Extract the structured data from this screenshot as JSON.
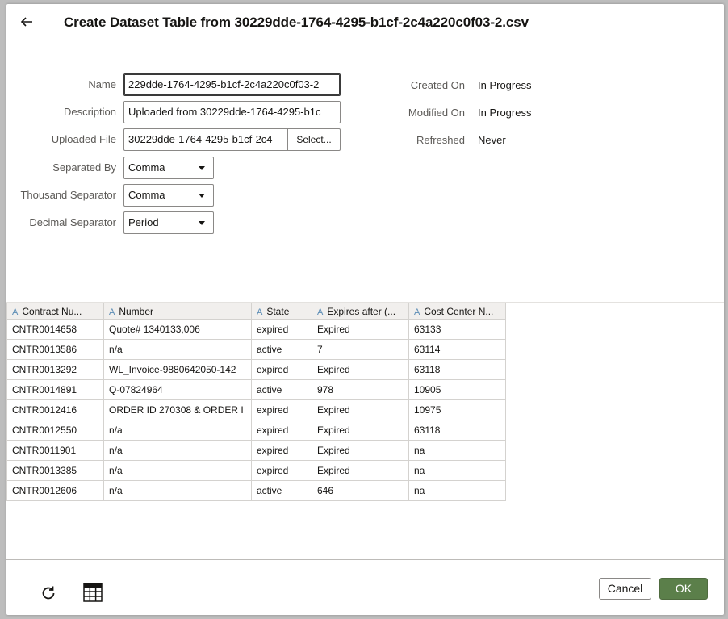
{
  "dialog": {
    "title": "Create Dataset Table from 30229dde-1764-4295-b1cf-2c4a220c0f03-2.csv"
  },
  "form": {
    "name_label": "Name",
    "name_value": "229dde-1764-4295-b1cf-2c4a220c0f03-2",
    "description_label": "Description",
    "description_value": "Uploaded from 30229dde-1764-4295-b1c",
    "uploaded_file_label": "Uploaded File",
    "uploaded_file_value": "30229dde-1764-4295-b1cf-2c4",
    "select_button": "Select...",
    "separated_by_label": "Separated By",
    "separated_by_value": "Comma",
    "thousand_separator_label": "Thousand Separator",
    "thousand_separator_value": "Comma",
    "decimal_separator_label": "Decimal Separator",
    "decimal_separator_value": "Period"
  },
  "meta": {
    "created_on_label": "Created On",
    "created_on_value": "In Progress",
    "modified_on_label": "Modified On",
    "modified_on_value": "In Progress",
    "refreshed_label": "Refreshed",
    "refreshed_value": "Never"
  },
  "grid": {
    "columns": [
      "Contract Nu...",
      "Number",
      "State",
      "Expires after (...",
      "Cost Center N..."
    ],
    "attr_glyph": "A",
    "rows": [
      [
        "CNTR0014658",
        "Quote# 1340133,006",
        "expired",
        "Expired",
        "63133"
      ],
      [
        "CNTR0013586",
        "n/a",
        "active",
        "7",
        "63114"
      ],
      [
        "CNTR0013292",
        "WL_Invoice-9880642050-142",
        "expired",
        "Expired",
        "63118"
      ],
      [
        "CNTR0014891",
        "Q-07824964",
        "active",
        "978",
        "10905"
      ],
      [
        "CNTR0012416",
        "ORDER ID 270308 & ORDER I",
        "expired",
        "Expired",
        "10975"
      ],
      [
        "CNTR0012550",
        "n/a",
        "expired",
        "Expired",
        "63118"
      ],
      [
        "CNTR0011901",
        "n/a",
        "expired",
        "Expired",
        "na"
      ],
      [
        "CNTR0013385",
        "n/a",
        "expired",
        "Expired",
        "na"
      ],
      [
        "CNTR0012606",
        "n/a",
        "active",
        "646",
        "na"
      ]
    ]
  },
  "footer": {
    "refresh_icon": "refresh-icon",
    "grid_icon": "table-grid-icon",
    "cancel_label": "Cancel",
    "ok_label": "OK"
  },
  "colors": {
    "ok_button": "#5b7f4a",
    "attr_icon": "#5b8cb5"
  }
}
